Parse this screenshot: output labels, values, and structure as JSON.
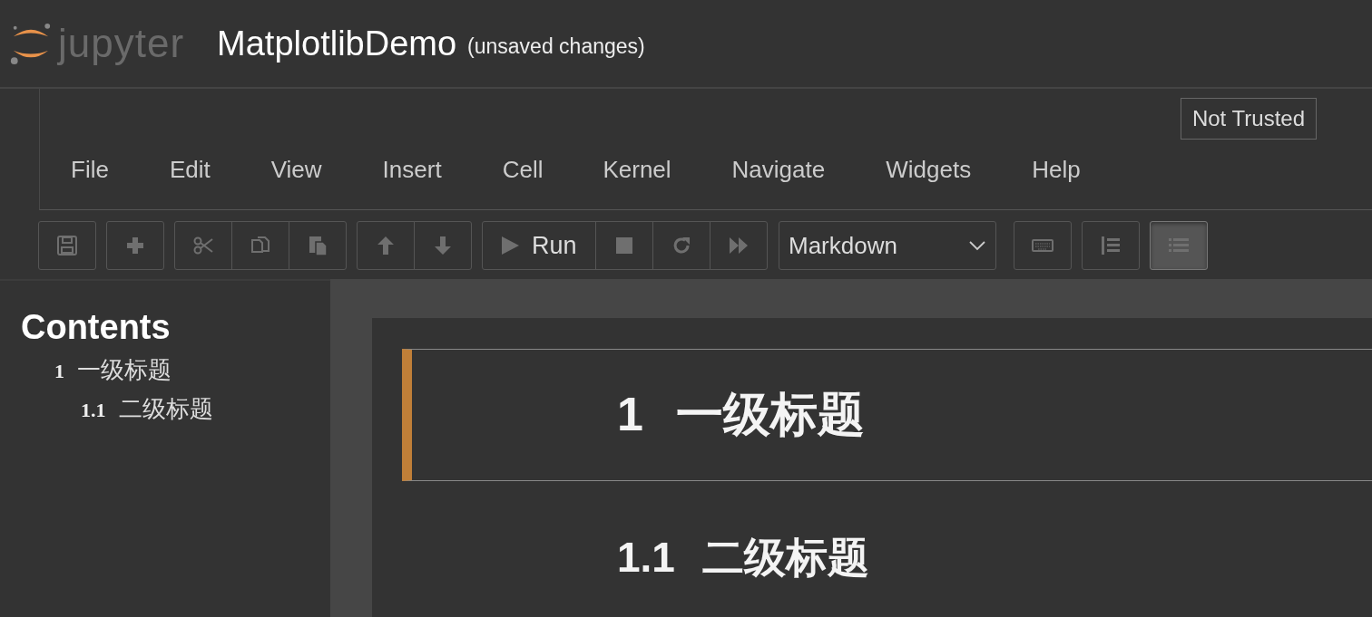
{
  "header": {
    "logo_text": "jupyter",
    "title": "MatplotlibDemo",
    "save_status": "(unsaved changes)"
  },
  "trust_badge": "Not Trusted",
  "menu": [
    "File",
    "Edit",
    "View",
    "Insert",
    "Cell",
    "Kernel",
    "Navigate",
    "Widgets",
    "Help"
  ],
  "toolbar": [
    {
      "kind": "group",
      "buttons": [
        {
          "kind": "save",
          "pressed": false
        }
      ]
    },
    {
      "kind": "group",
      "buttons": [
        {
          "kind": "plus",
          "pressed": false
        }
      ]
    },
    {
      "kind": "group",
      "buttons": [
        {
          "kind": "cut",
          "pressed": false
        },
        {
          "kind": "copy",
          "pressed": false
        },
        {
          "kind": "paste",
          "pressed": false
        }
      ]
    },
    {
      "kind": "group",
      "buttons": [
        {
          "kind": "up",
          "pressed": false
        },
        {
          "kind": "down",
          "pressed": false
        }
      ]
    },
    {
      "kind": "group",
      "buttons": [
        {
          "kind": "run",
          "label": "Run",
          "pressed": false
        },
        {
          "kind": "stop",
          "pressed": false
        },
        {
          "kind": "restart",
          "pressed": false
        },
        {
          "kind": "forward",
          "pressed": false
        }
      ]
    },
    {
      "kind": "select",
      "value": "Markdown"
    },
    {
      "kind": "group",
      "buttons": [
        {
          "kind": "keyboard",
          "pressed": false
        }
      ]
    },
    {
      "kind": "group",
      "buttons": [
        {
          "kind": "numbered",
          "pressed": false
        }
      ]
    },
    {
      "kind": "group",
      "buttons": [
        {
          "kind": "list",
          "pressed": true
        }
      ]
    }
  ],
  "toc": {
    "title": "Contents",
    "items": [
      {
        "number": "1",
        "text": "一级标题",
        "children": [
          {
            "number": "1.1",
            "text": "二级标题"
          }
        ]
      }
    ]
  },
  "cells": [
    {
      "kind": "h1",
      "number": "1",
      "text": "一级标题",
      "selected": true
    },
    {
      "kind": "h2",
      "number": "1.1",
      "text": "二级标题",
      "selected": false
    }
  ]
}
